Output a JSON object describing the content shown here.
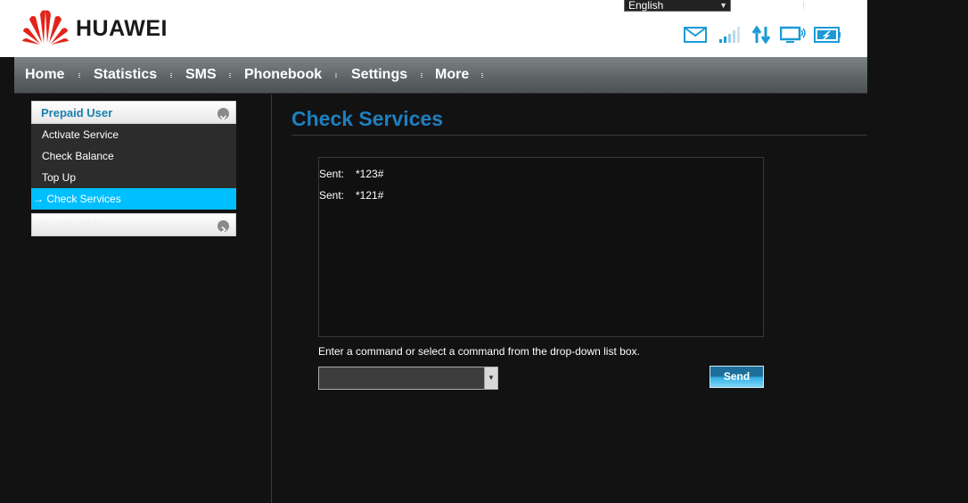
{
  "header": {
    "brand": "HUAWEI",
    "language": "English",
    "status_icons": [
      "mail-icon",
      "signal-icon",
      "data-transfer-icon",
      "connection-icon",
      "battery-icon"
    ]
  },
  "nav": {
    "items": [
      "Home",
      "Statistics",
      "SMS",
      "Phonebook",
      "Settings",
      "More"
    ]
  },
  "sidebar": {
    "prepaid": {
      "title": "Prepaid User",
      "items": [
        "Activate Service",
        "Check Balance",
        "Top Up",
        "→ Check Services"
      ]
    },
    "postpaid": {
      "title": "Postpaid User"
    }
  },
  "main": {
    "title": "Check Services",
    "log": [
      {
        "label": "Sent:",
        "command": "*123#"
      },
      {
        "label": "Sent:",
        "command": "*121#"
      }
    ],
    "hint": "Enter a command or select a command from the drop-down list box.",
    "command_value": "",
    "send_label": "Send"
  },
  "colors": {
    "accent": "#00bfff",
    "title": "#1e7fc0",
    "brand_red": "#e2231a",
    "icon_blue": "#1d9ad6"
  }
}
